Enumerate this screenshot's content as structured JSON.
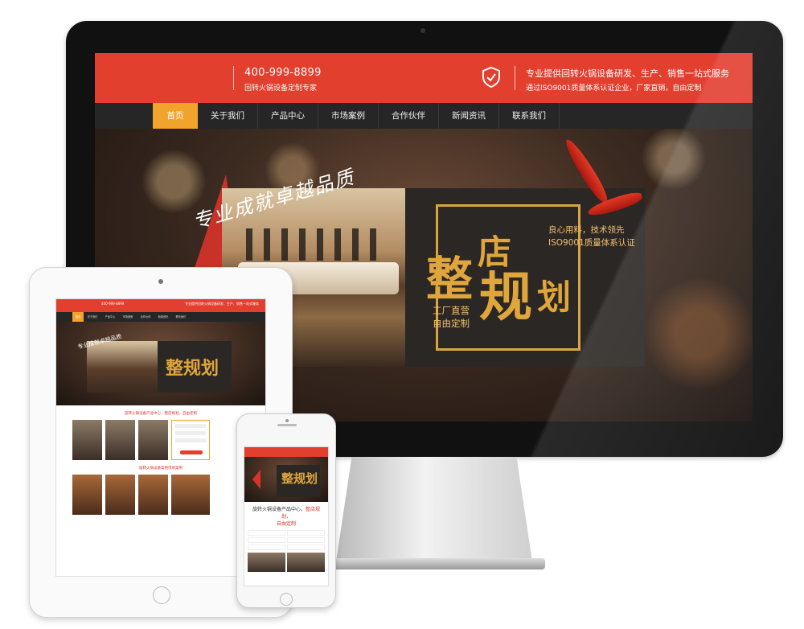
{
  "desktop": {
    "header": {
      "phone": "400-999-8899",
      "phone_sub": "回转火锅设备定制专家",
      "service_line1": "专业提供回转火锅设备研发、生产、销售一站式服务",
      "service_line2": "通过ISO9001质量体系认证企业，厂家直销，自由定制",
      "brand_color": "#e23f2f",
      "icon": "shield-check-icon"
    },
    "nav": [
      {
        "label": "首页",
        "active": true
      },
      {
        "label": "关于我们"
      },
      {
        "label": "产品中心"
      },
      {
        "label": "市场案例"
      },
      {
        "label": "合作伙伴"
      },
      {
        "label": "新闻资讯"
      },
      {
        "label": "联系我们"
      }
    ],
    "hero": {
      "slogan": "专业成就卓越品质",
      "big_char1": "整",
      "big_char2": "店",
      "big_char3": "规",
      "big_char4": "划",
      "tag1": "良心用料，技术领先",
      "tag2": "ISO9001质量体系认证",
      "tag3": "工厂直营",
      "tag4": "自由定制",
      "accent_color": "#e0a63c"
    },
    "carousel_dots": 2
  },
  "tablet": {
    "hero_slogan": "专业成就卓越品质",
    "hero_big": "整规划",
    "section1_title": "旋转火锅设备产品中心，整店规划，自由定制",
    "section2_title": "旋转火锅设备案例市场案例"
  },
  "phone": {
    "hero_big": "整规划",
    "title_a": "旋转火锅设备产品中心，",
    "title_b": "整店规划，",
    "title_c": "自由定制"
  }
}
